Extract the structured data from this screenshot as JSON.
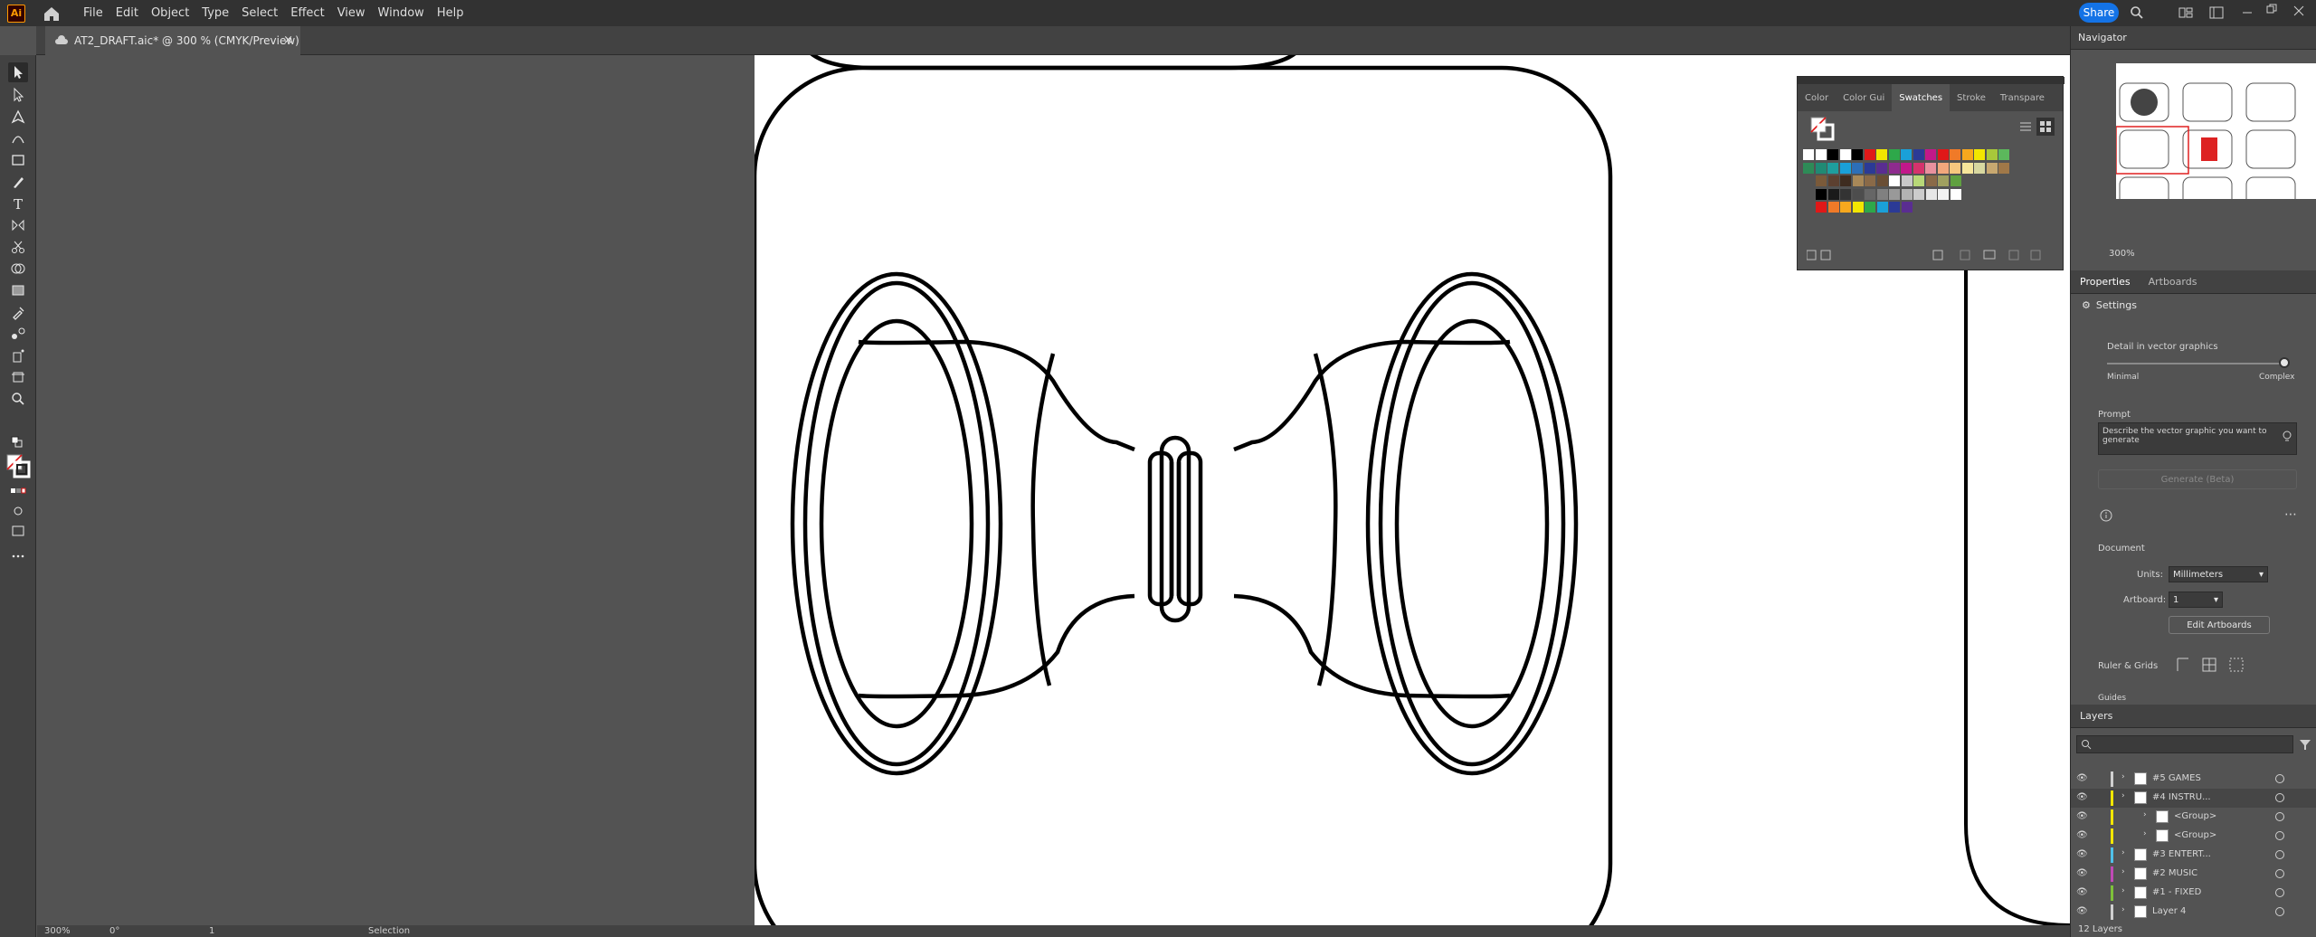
{
  "app": {
    "logo_text": "Ai",
    "menu": [
      "File",
      "Edit",
      "Object",
      "Type",
      "Select",
      "Effect",
      "View",
      "Window",
      "Help"
    ],
    "share_label": "Share"
  },
  "document_tab": {
    "title": "AT2_DRAFT.aic* @ 300 % (CMYK/Preview)",
    "close": "×"
  },
  "swatches_panel": {
    "tabs": [
      "Color",
      "Color Gui",
      "Swatches",
      "Stroke",
      "Transpare"
    ],
    "active_tab": "Swatches"
  },
  "navigator": {
    "title": "Navigator",
    "zoom": "300%"
  },
  "properties": {
    "tabs": [
      "Properties",
      "Artboards"
    ],
    "settings_label": "Settings",
    "detail_label": "Detail in vector graphics",
    "detail_min": "Minimal",
    "detail_max": "Complex",
    "prompt_label": "Prompt",
    "prompt_placeholder": "Describe the vector graphic you want to generate",
    "generate_label": "Generate (Beta)",
    "document_label": "Document",
    "units_label": "Units:",
    "units_value": "Millimeters",
    "artboard_label": "Artboard:",
    "artboard_value": "1",
    "edit_artboards": "Edit Artboards",
    "ruler_grids": "Ruler & Grids",
    "guides": "Guides"
  },
  "layers": {
    "title": "Layers",
    "count": "12 Layers",
    "rows": [
      {
        "name": "#5 GAMES",
        "color": "#d0d0d0"
      },
      {
        "name": "#4 INSTRU...",
        "color": "#f2e600"
      },
      {
        "name": "<Group>",
        "color": "#f2e600"
      },
      {
        "name": "<Group>",
        "color": "#f2e600"
      },
      {
        "name": "#3 ENTERT...",
        "color": "#4fc1e9"
      },
      {
        "name": "#2 MUSIC",
        "color": "#c04ab5"
      },
      {
        "name": "#1 - FIXED",
        "color": "#7ec13a"
      },
      {
        "name": "Layer 4",
        "color": "#d0d0d0"
      }
    ]
  },
  "statusbar": {
    "zoom": "300%",
    "rotation": "0°",
    "artboard": "1",
    "tool": "Selection"
  }
}
